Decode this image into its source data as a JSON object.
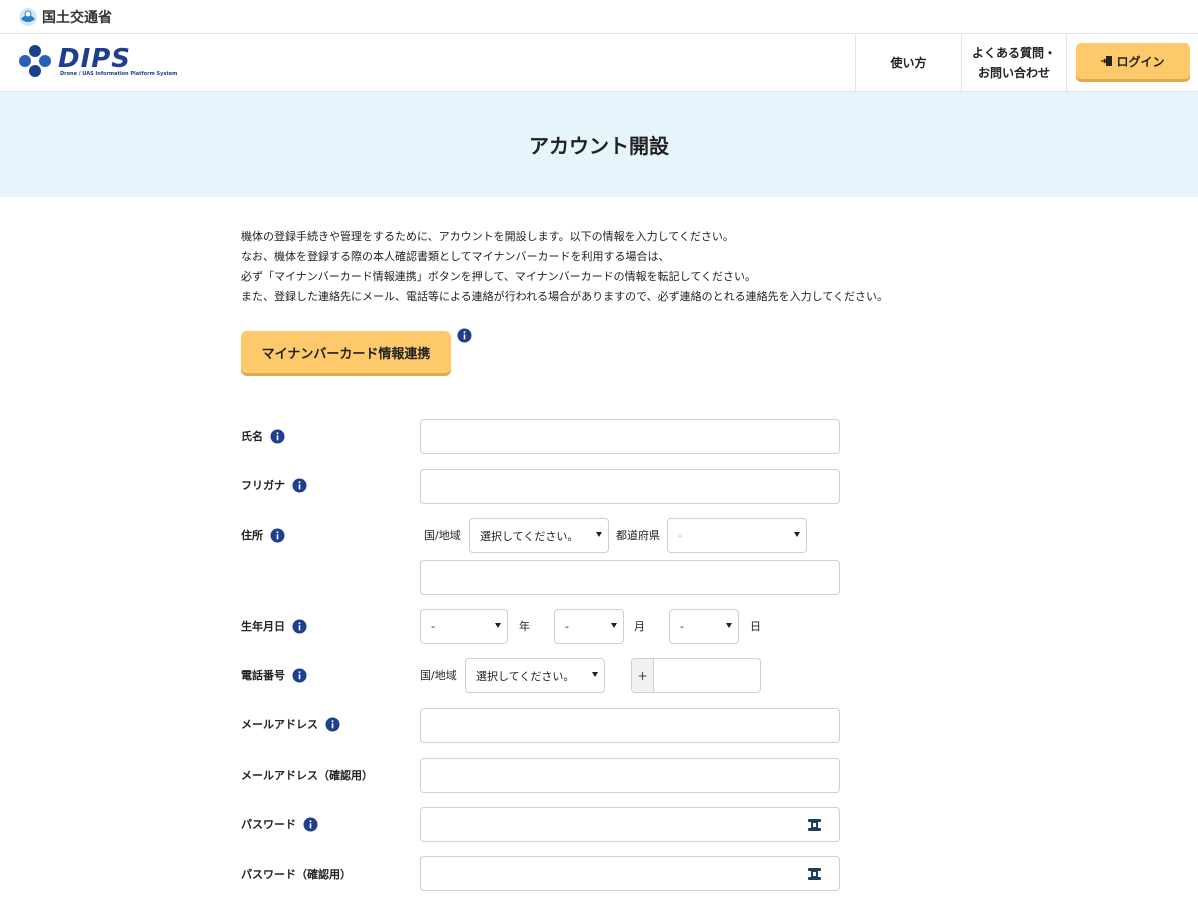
{
  "ministry": {
    "name": "国土交通省",
    "logo_icon": "mlit-logo-icon"
  },
  "brand": {
    "word": "DIPS",
    "subtitle": "Drone / UAS Information Platform System",
    "logo_icon": "dips-logo-icon"
  },
  "nav": {
    "howto": "使い方",
    "faq_line1": "よくある質問・",
    "faq_line2": "お問い合わせ",
    "login": "ログイン"
  },
  "page": {
    "title": "アカウント開設"
  },
  "intro": [
    "機体の登録手続きや管理をするために、アカウントを開設します。以下の情報を入力してください。",
    "なお、機体を登録する際の本人確認書類としてマイナンバーカードを利用する場合は、",
    "必ず「マイナンバーカード情報連携」ボタンを押して、マイナンバーカードの情報を転記してください。",
    "また、登録した連絡先にメール、電話等による連絡が行われる場合がありますので、必ず連絡のとれる連絡先を入力してください。"
  ],
  "mynumber_button": "マイナンバーカード情報連携",
  "form": {
    "name_label": "氏名",
    "furigana_label": "フリガナ",
    "address_label": "住所",
    "country_label": "国/地域",
    "country_value": "選択してください。",
    "prefecture_label": "都道府県",
    "prefecture_value": "-",
    "birthdate_label": "生年月日",
    "year_value": "-",
    "year_unit": "年",
    "month_value": "-",
    "month_unit": "月",
    "day_value": "-",
    "day_unit": "日",
    "phone_label": "電話番号",
    "phone_country_label": "国/地域",
    "phone_country_value": "選択してください。",
    "phone_prefix": "+",
    "email_label": "メールアドレス",
    "email_confirm_label": "メールアドレス（確認用）",
    "password_label": "パスワード",
    "password_confirm_label": "パスワード（確認用）"
  },
  "colors": {
    "accent_button": "#fdc96b",
    "title_band": "#e6f4fb",
    "brand": "#1e3f8c",
    "info": "#1e3f8c"
  }
}
